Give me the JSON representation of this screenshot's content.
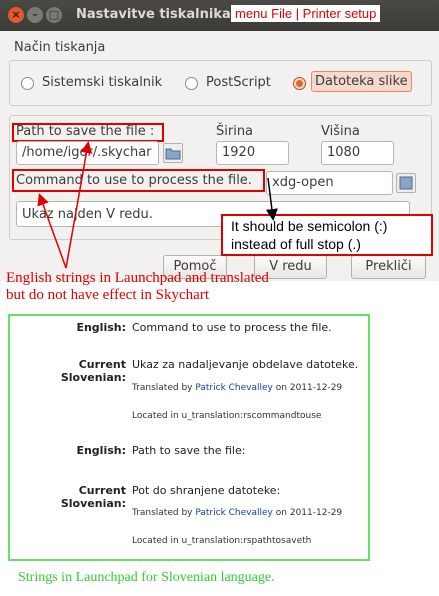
{
  "window": {
    "title": "Nastavitve tiskalnika",
    "close_glyph": "×",
    "min_glyph": "–",
    "max_glyph": "□"
  },
  "annotation_menu": "menu File | Printer setup",
  "print_mode": {
    "legend": "Način tiskanja",
    "options": [
      {
        "label": "Sistemski tiskalnik",
        "selected": false
      },
      {
        "label": "PostScript",
        "selected": false
      },
      {
        "label": "Datoteka slike",
        "selected": true
      }
    ]
  },
  "path": {
    "label": "Path to save the file :",
    "value": "/home/igor/.skychar"
  },
  "width": {
    "label": "Širina",
    "value": "1920"
  },
  "height": {
    "label": "Višina",
    "value": "1080"
  },
  "command": {
    "label": "Command to use to process the file.",
    "value": "xdg-open"
  },
  "status": {
    "text": "Ukaz najden V redu."
  },
  "buttons": {
    "help": "Pomoč",
    "ok": "V redu",
    "cancel": "Prekliči"
  },
  "annotation_semicolon": {
    "line1": "It should be semicolon (:)",
    "line2": "instead of full stop (.)"
  },
  "annotation_english": {
    "line1": "English strings in Launchpad and translated",
    "line2": "but do not have effect in Skychart"
  },
  "launchpad": {
    "entries": [
      {
        "english_label": "English:",
        "english": "Command to use to process the file.",
        "current_label": "Current Slovenian:",
        "current": "Ukaz za nadaljevanje obdelave datoteke.",
        "translated_by_prefix": "Translated by",
        "translator": "Patrick Chevalley",
        "date_text": "on 2011-12-29",
        "located": "Located in u_translation:rscommandtouse"
      },
      {
        "english_label": "English:",
        "english": "Path to save the file:",
        "current_label": "Current Slovenian:",
        "current": "Pot do shranjene datoteke:",
        "translated_by_prefix": "Translated by",
        "translator": "Patrick Chevalley",
        "date_text": "on 2011-12-29",
        "located": "Located in u_translation:rspathtosaveth"
      }
    ]
  },
  "annotation_green": "Strings in Launchpad for Slovenian language.",
  "colors": {
    "annotation_red": "#e00000",
    "annotation_green": "#33cc33",
    "accent_orange": "#e0642a"
  }
}
